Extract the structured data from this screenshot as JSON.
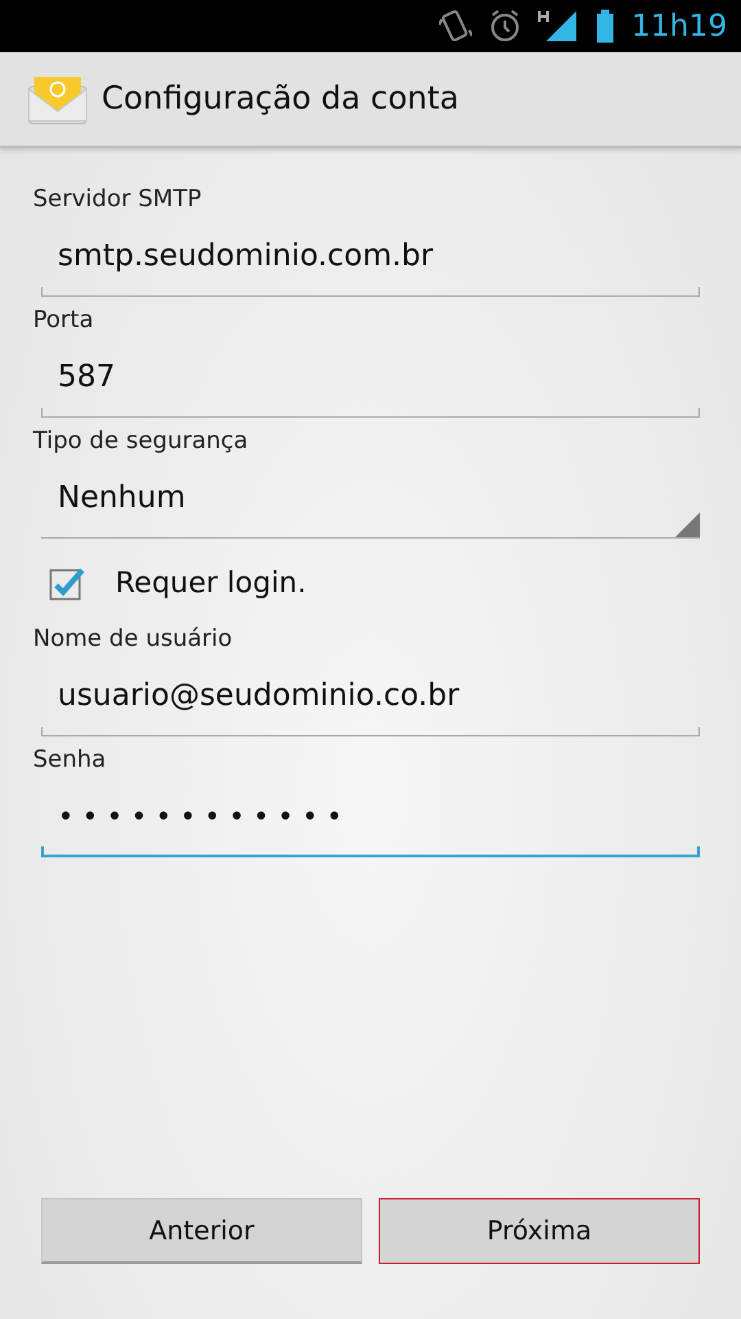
{
  "status_bar": {
    "time": "11h19"
  },
  "header": {
    "title": "Configuração da conta"
  },
  "fields": [
    {
      "kind": "text",
      "label": "Servidor SMTP",
      "value": "smtp.seudominio.com.br",
      "focused": false
    },
    {
      "kind": "text",
      "label": "Porta",
      "value": "587",
      "focused": false
    },
    {
      "kind": "spinner",
      "label": "Tipo de segurança",
      "value": "Nenhum"
    },
    {
      "kind": "checkbox",
      "label": "Requer login.",
      "checked": true
    },
    {
      "kind": "text",
      "label": "Nome de usuário",
      "value": "usuario@seudominio.co.br",
      "focused": false
    },
    {
      "kind": "password",
      "label": "Senha",
      "value": "••••••••••••",
      "focused": true
    }
  ],
  "buttons": [
    {
      "label": "Anterior",
      "highlighted": false
    },
    {
      "label": "Próxima",
      "highlighted": true
    }
  ]
}
